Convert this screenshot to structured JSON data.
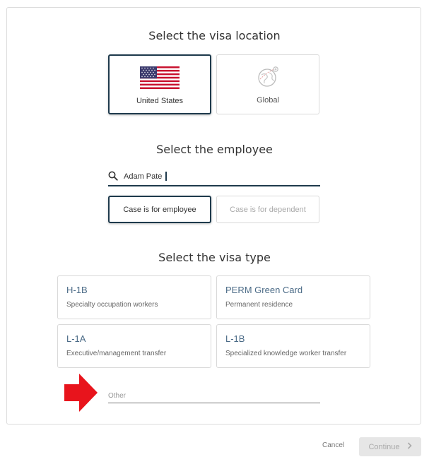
{
  "location": {
    "title": "Select the visa location",
    "options": [
      {
        "label": "United States",
        "icon": "us-flag-icon",
        "selected": true
      },
      {
        "label": "Global",
        "icon": "globe-plane-icon",
        "selected": false
      }
    ]
  },
  "employee": {
    "title": "Select the employee",
    "search": {
      "value": "Adam Pate",
      "icon": "search-icon"
    },
    "case_options": [
      {
        "label": "Case is for employee",
        "selected": true
      },
      {
        "label": "Case is for dependent",
        "selected": false
      }
    ]
  },
  "visa_type": {
    "title": "Select the visa type",
    "cards": [
      {
        "title": "H-1B",
        "subtitle": "Specialty occupation workers"
      },
      {
        "title": "PERM Green Card",
        "subtitle": "Permanent residence"
      },
      {
        "title": "L-1A",
        "subtitle": "Executive/management transfer"
      },
      {
        "title": "L-1B",
        "subtitle": "Specialized knowledge worker transfer"
      }
    ],
    "other": {
      "placeholder": "Other"
    }
  },
  "footer": {
    "cancel_label": "Cancel",
    "continue_label": "Continue",
    "continue_icon": "chevron-right-icon"
  },
  "colors": {
    "selected_border": "#1e3a4c",
    "visa_title": "#4a6a86",
    "annotation_arrow": "#e8141c"
  }
}
